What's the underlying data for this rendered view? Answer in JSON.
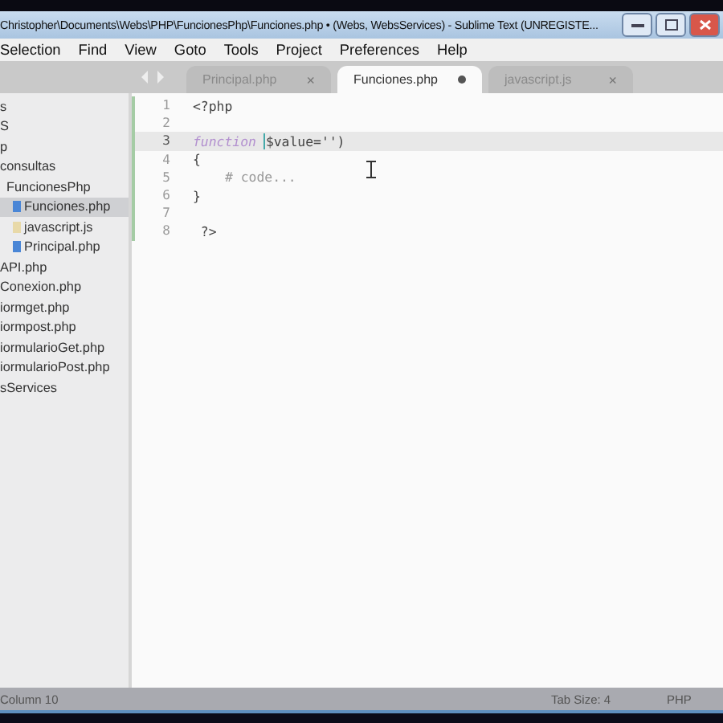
{
  "window": {
    "title": "Christopher\\Documents\\Webs\\PHP\\FuncionesPhp\\Funciones.php • (Webs, WebsServices) - Sublime Text (UNREGISTE..."
  },
  "menu": [
    "Selection",
    "Find",
    "View",
    "Goto",
    "Tools",
    "Project",
    "Preferences",
    "Help"
  ],
  "tabs": [
    {
      "label": "Principal.php",
      "selected": false,
      "modified": false,
      "close": "×"
    },
    {
      "label": "Funciones.php",
      "selected": true,
      "modified": true
    },
    {
      "label": "javascript.js",
      "selected": false,
      "modified": false,
      "close": "×"
    }
  ],
  "sidebar": {
    "items": [
      {
        "label": "s",
        "selected": false
      },
      {
        "label": "S",
        "selected": false
      },
      {
        "label": "p",
        "selected": false
      },
      {
        "label": "consultas",
        "selected": false,
        "children": [
          {
            "label": "FuncionesPhp",
            "selected": false,
            "children": [
              {
                "label": "Funciones.php",
                "selected": true,
                "kind": "php"
              },
              {
                "label": "javascript.js",
                "selected": false,
                "kind": "js"
              },
              {
                "label": "Principal.php",
                "selected": false,
                "kind": "php"
              }
            ]
          }
        ]
      },
      {
        "label": "API.php",
        "selected": false
      },
      {
        "label": "Conexion.php",
        "selected": false
      },
      {
        "label": "iormget.php",
        "selected": false
      },
      {
        "label": "iormpost.php",
        "selected": false
      },
      {
        "label": "iormularioGet.php",
        "selected": false
      },
      {
        "label": "iormularioPost.php",
        "selected": false
      },
      {
        "label": "sServices",
        "selected": false
      }
    ]
  },
  "editor": {
    "lines": [
      {
        "number": "1",
        "current": false,
        "tokens": [
          {
            "kind": "tag",
            "text": "<?php"
          }
        ]
      },
      {
        "number": "2",
        "current": false
      },
      {
        "number": "3",
        "current": true,
        "tokens": [
          {
            "kind": "keyword",
            "text": "function"
          },
          {
            "kind": "cursor"
          },
          {
            "kind": "plain",
            "text": "$value='')"
          }
        ]
      },
      {
        "number": "4",
        "current": false,
        "tokens": [
          {
            "kind": "plain",
            "text": "{"
          }
        ]
      },
      {
        "number": "5",
        "current": false,
        "tokens": [
          {
            "kind": "comment",
            "text": "# code..."
          }
        ]
      },
      {
        "number": "6",
        "current": false,
        "tokens": [
          {
            "kind": "plain",
            "text": "}"
          }
        ]
      },
      {
        "number": "7",
        "current": false
      },
      {
        "number": "8",
        "current": false,
        "tokens": [
          {
            "kind": "tag",
            "text": " ?>"
          }
        ]
      }
    ]
  },
  "status_bar": {
    "position": "Column 10",
    "tab_size": "Tab Size: 4",
    "syntax": "PHP"
  }
}
